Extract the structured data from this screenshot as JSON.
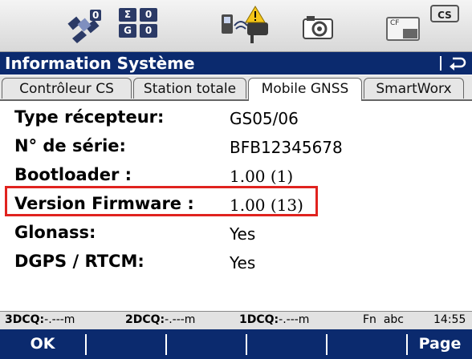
{
  "status": {
    "sat_count": "0",
    "sigma_label": "Σ",
    "sigma_value": "0",
    "g_label": "G",
    "g_value": "0",
    "cf_label": "CF",
    "cs_label": "CS",
    "icons": [
      "satellite-icon",
      "position-quality-icon",
      "rover-warning-icon",
      "camera-icon",
      "cf-card-icon",
      "cs-controller-icon"
    ]
  },
  "titlebar": {
    "title": "Information Système"
  },
  "tabs": [
    {
      "label": "Contrôleur CS",
      "active": false
    },
    {
      "label": "Station totale",
      "active": false
    },
    {
      "label": "Mobile GNSS",
      "active": true
    },
    {
      "label": "SmartWorx",
      "active": false
    }
  ],
  "fields": [
    {
      "label": "Type récepteur:",
      "value": "GS05/06"
    },
    {
      "label": "N° de série:",
      "value": "BFB12345678"
    },
    {
      "label": "Bootloader :",
      "value": "1.00 (1)"
    },
    {
      "label": "Version Firmware :",
      "value": "1.00 (13)"
    },
    {
      "label": "Glonass:",
      "value": "Yes"
    },
    {
      "label": "DGPS / RTCM:",
      "value": "Yes"
    }
  ],
  "infobar": {
    "dcq3_label": "3DCQ:",
    "dcq3_value": "-.---m",
    "dcq2_label": "2DCQ:",
    "dcq2_value": "-.---m",
    "dcq1_label": "1DCQ:",
    "dcq1_value": "-.---m",
    "mode": "Fn  abc",
    "time": "14:55"
  },
  "softkeys": {
    "ok": "OK",
    "page": "Page"
  },
  "colors": {
    "title_bg": "#0b2a6e",
    "highlight": "#e0231f"
  }
}
